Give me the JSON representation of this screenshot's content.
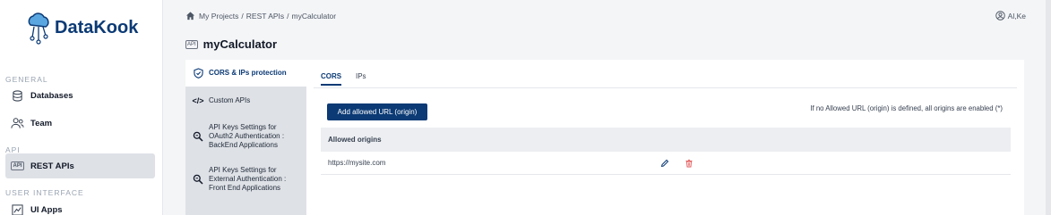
{
  "app": {
    "name": "DataKook"
  },
  "sidebar": {
    "sections": [
      {
        "label": "GENERAL"
      },
      {
        "label": "API"
      },
      {
        "label": "USER INTERFACE"
      }
    ],
    "items": [
      {
        "label": "Databases",
        "icon": "database-icon"
      },
      {
        "label": "Team",
        "icon": "team-icon"
      },
      {
        "label": "REST APIs",
        "icon": "api-icon",
        "active": true
      },
      {
        "label": "UI Apps",
        "icon": "chart-icon"
      }
    ]
  },
  "breadcrumb": {
    "items": [
      "My Projects",
      "REST APIs",
      "myCalculator"
    ],
    "separator": "/"
  },
  "user": {
    "name": "Al,Ke"
  },
  "page": {
    "badge": "API",
    "title": "myCalculator"
  },
  "menu": {
    "items": [
      {
        "label": "CORS & IPs protection",
        "icon": "shield-icon",
        "active": true
      },
      {
        "label": "Custom APIs",
        "icon": "code-icon"
      },
      {
        "lines": [
          "API Keys Settings for",
          "OAuth2 Authentication :",
          "BackEnd Applications"
        ],
        "icon": "key-search-icon"
      },
      {
        "lines": [
          "API Keys Settings for",
          "External Authentication :",
          "Front End Applications"
        ],
        "icon": "key-search-icon"
      }
    ]
  },
  "tabs": [
    {
      "label": "CORS",
      "active": true
    },
    {
      "label": "IPs",
      "active": false
    }
  ],
  "cors": {
    "add_button": "Add allowed URL (origin)",
    "info": "If no Allowed URL (origin) is defined, all origins are enabled (*)",
    "table_header": "Allowed origins",
    "rows": [
      {
        "origin": "https://mysite.com"
      }
    ]
  },
  "colors": {
    "brand": "#0b3a75",
    "delete": "#e05555",
    "edit": "#0b3a75"
  }
}
